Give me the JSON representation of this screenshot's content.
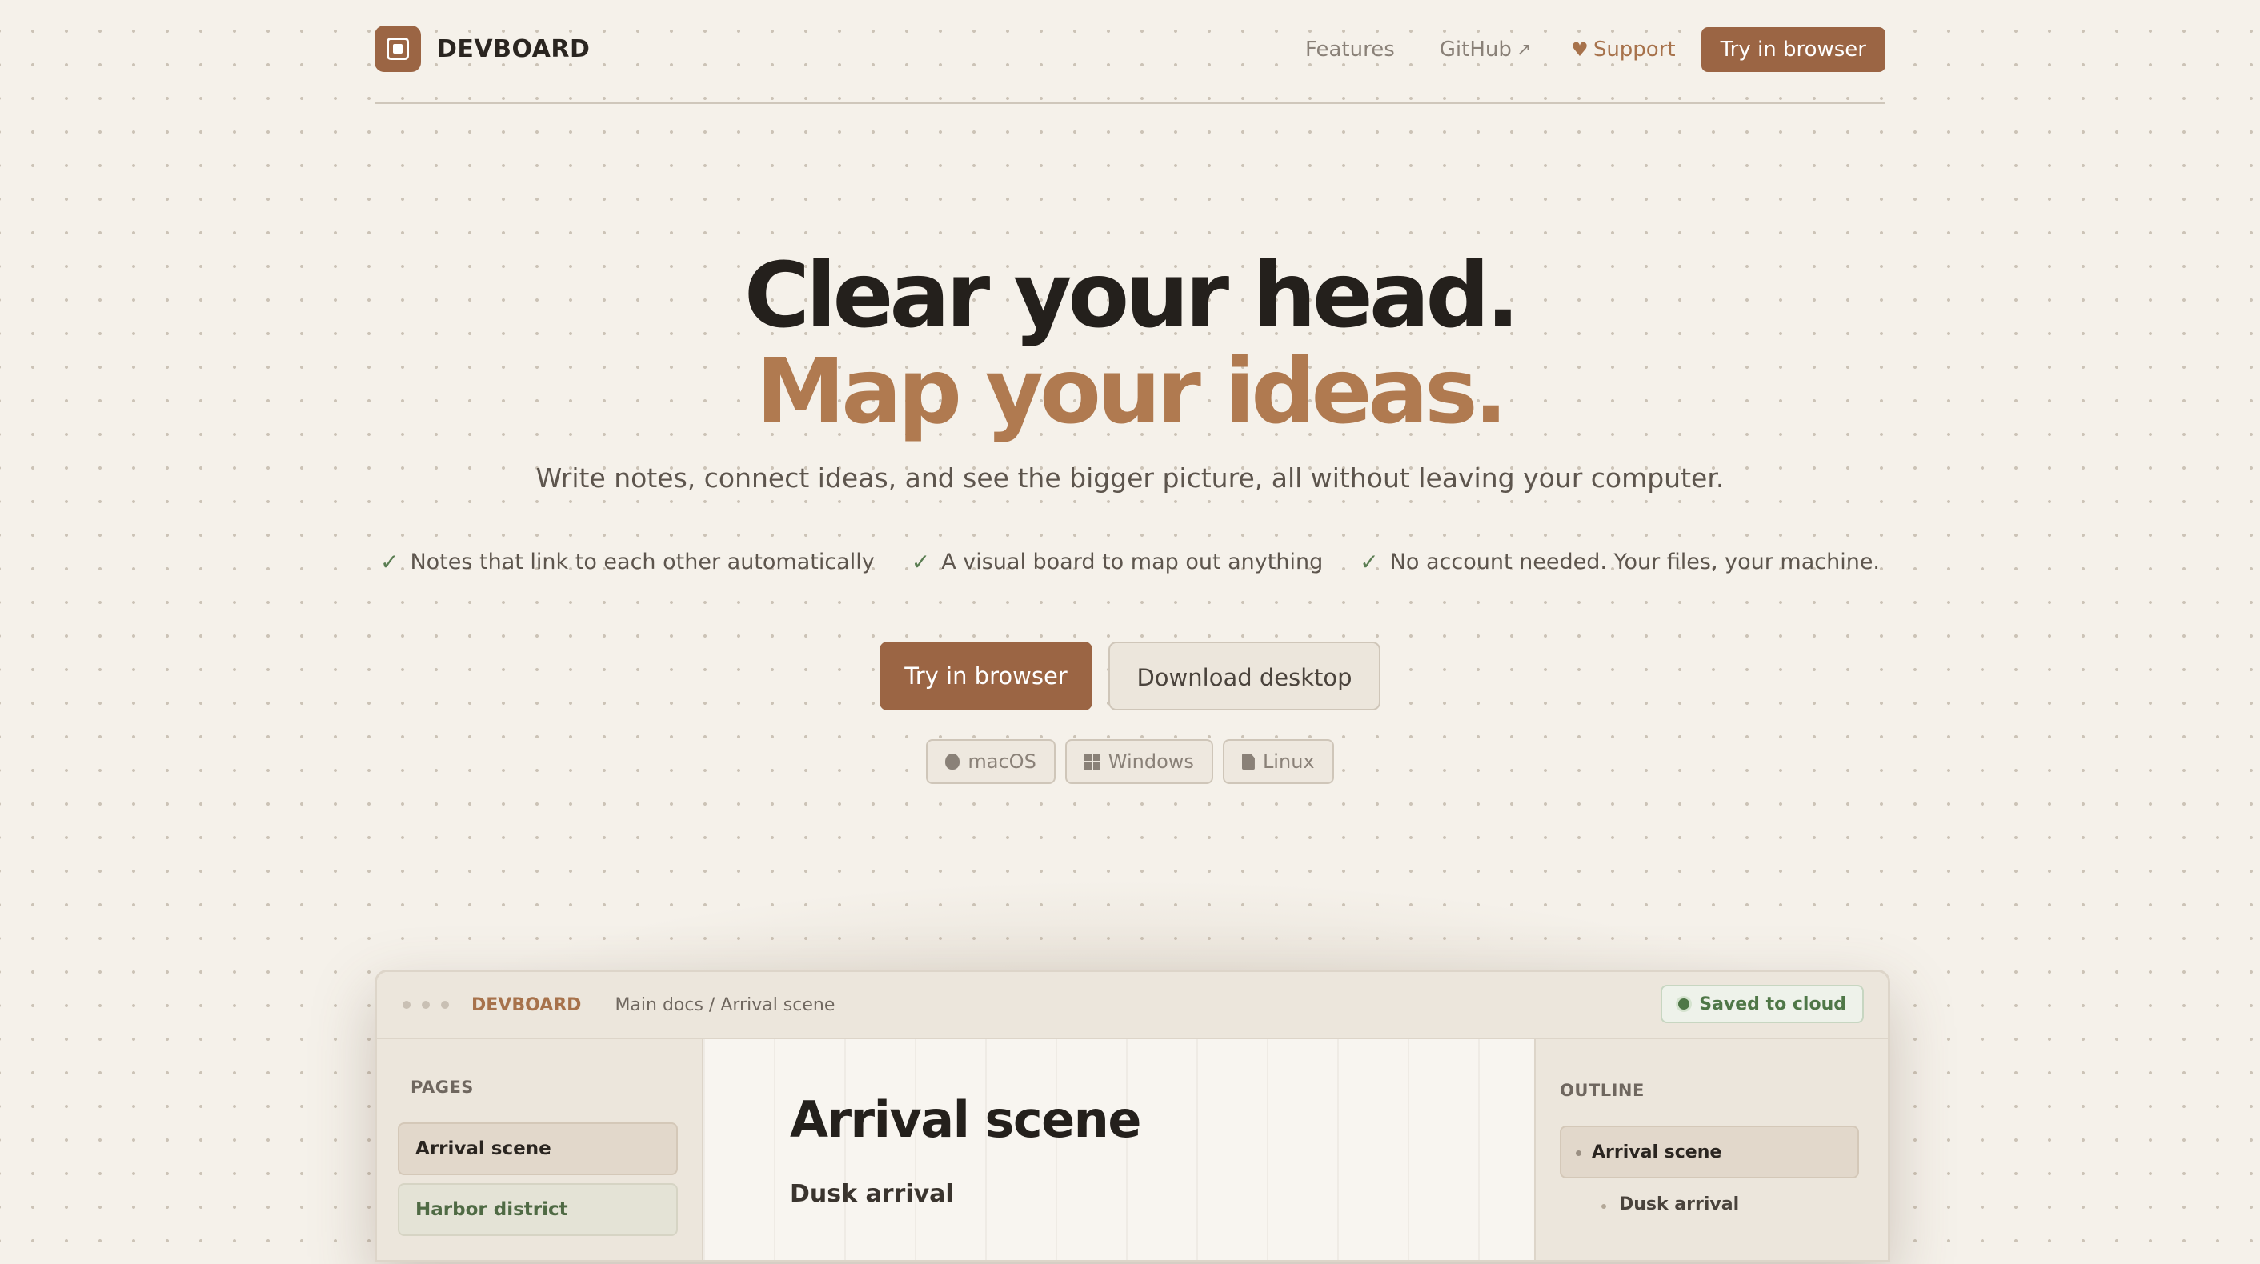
{
  "nav": {
    "brand": "DEVBOARD",
    "links": {
      "features": "Features",
      "github": "GitHub",
      "support": "Support"
    },
    "cta": "Try in browser"
  },
  "hero": {
    "line1": "Clear your head.",
    "line2": "Map your ideas.",
    "subtitle": "Write notes, connect ideas, and see the bigger picture, all without leaving your computer.",
    "features": [
      "Notes that link to each other automatically",
      "A visual board to map out anything",
      "No account needed. Your files, your machine."
    ],
    "primary_cta": "Try in browser",
    "secondary_cta": "Download desktop",
    "platforms": [
      "macOS",
      "Windows",
      "Linux"
    ]
  },
  "app": {
    "brand": "DEVBOARD",
    "breadcrumb": "Main docs / Arrival scene",
    "status": "Saved to cloud",
    "sidebar": {
      "label": "PAGES",
      "items": [
        "Arrival scene",
        "Harbor district"
      ]
    },
    "editor": {
      "title": "Arrival scene",
      "heading": "Dusk arrival"
    },
    "outline": {
      "label": "OUTLINE",
      "items": [
        "Arrival scene",
        "Dusk arrival"
      ]
    }
  },
  "colors": {
    "accent": "#9b6544",
    "accent_text": "#b07a50",
    "background": "#f5f1ea",
    "success": "#4f7747"
  }
}
